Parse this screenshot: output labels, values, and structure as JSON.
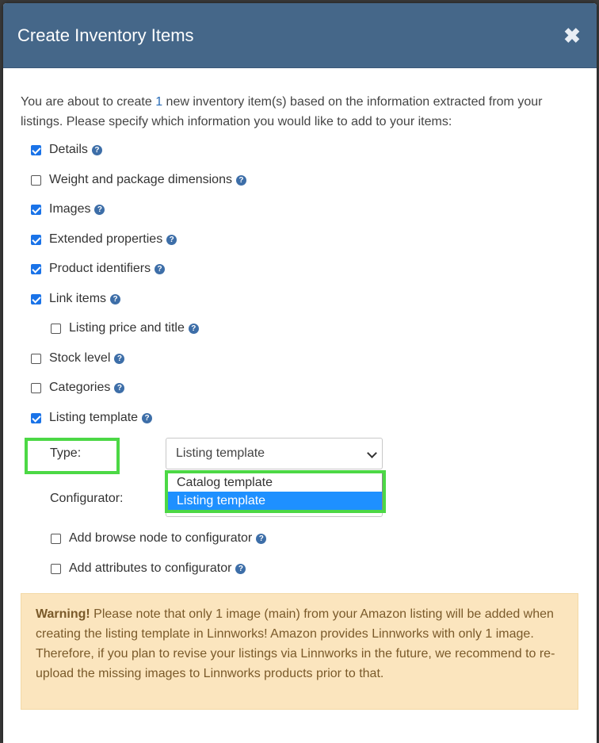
{
  "dialog": {
    "title": "Create Inventory Items",
    "close_glyph": "✖"
  },
  "intro": {
    "before": "You are about to create ",
    "count": "1",
    "after": " new inventory item(s) based on the information extracted from your listings. Please specify which information you would like to add to your items:"
  },
  "options": [
    {
      "label": "Details",
      "checked": true
    },
    {
      "label": "Weight and package dimensions",
      "checked": false
    },
    {
      "label": "Images",
      "checked": true
    },
    {
      "label": "Extended properties",
      "checked": true
    },
    {
      "label": "Product identifiers",
      "checked": true
    },
    {
      "label": "Link items",
      "checked": true
    },
    {
      "label": "Listing price and title",
      "checked": false
    },
    {
      "label": "Stock level",
      "checked": false
    },
    {
      "label": "Categories",
      "checked": false
    },
    {
      "label": "Listing template",
      "checked": true
    }
  ],
  "template": {
    "type_label": "Type:",
    "type_value": "Listing template",
    "configurator_label": "Configurator:",
    "dropdown_options": [
      "Catalog template",
      "Listing template"
    ],
    "selected_option": "Listing template",
    "add_browse_node": {
      "label": "Add browse node to configurator",
      "checked": false
    },
    "add_attributes": {
      "label": "Add attributes to configurator",
      "checked": false
    }
  },
  "help_glyph": "?",
  "warning": {
    "title": "Warning!",
    "text": " Please note that only 1 image (main) from your Amazon listing will be added when creating the listing template in Linnworks! Amazon provides Linnworks with only 1 image. Therefore, if you plan to revise your listings via Linnworks in the future, we recommend to re-upload the missing images to Linnworks products prior to that."
  },
  "colors": {
    "header_bg": "#456789",
    "checkbox_accent": "#1a73e8",
    "highlight_green": "#4cd845",
    "selected_option_bg": "#1e90ff",
    "warning_bg": "#fbe5be"
  }
}
